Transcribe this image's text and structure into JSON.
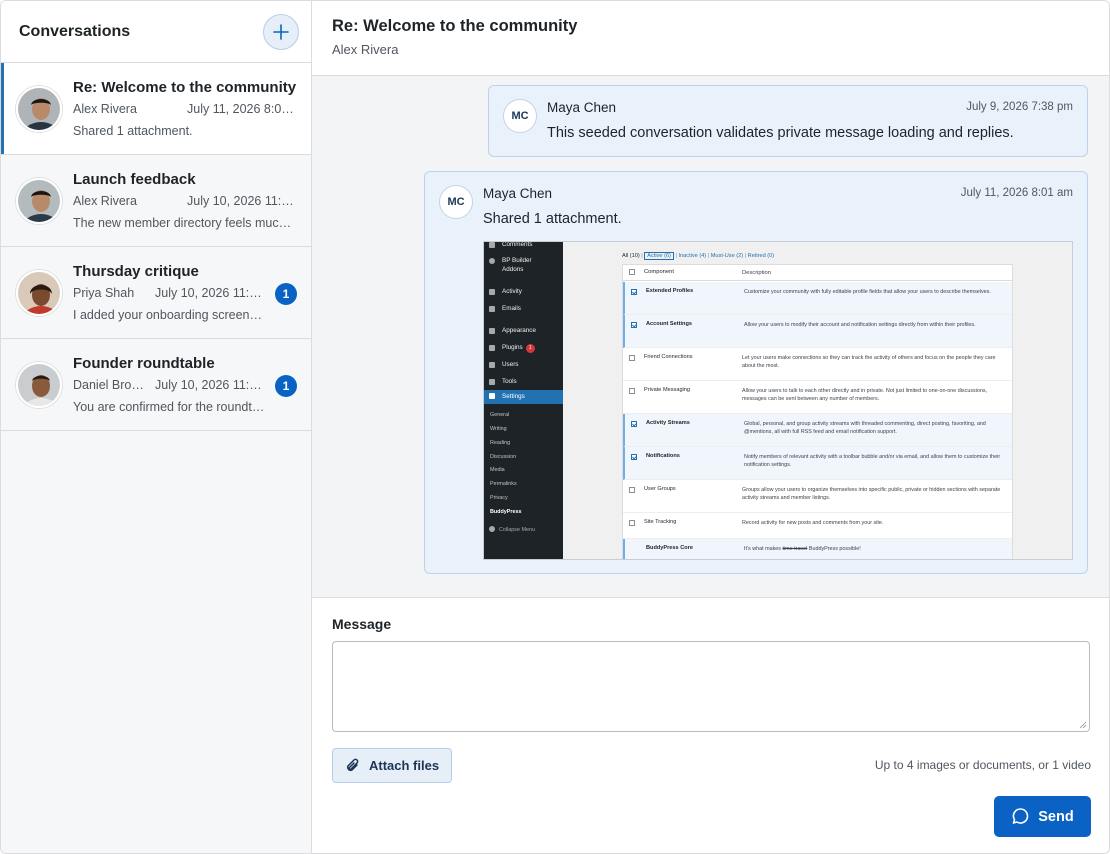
{
  "sidebar": {
    "title": "Conversations",
    "new_icon": "plus-icon",
    "conversations": [
      {
        "title": "Re: Welcome to the community",
        "author": "Alex Rivera",
        "date": "July 11, 2026 8:01 am",
        "preview": "Shared 1 attachment.",
        "active": true
      },
      {
        "title": "Launch feedback",
        "author": "Alex Rivera",
        "date": "July 10, 2026 11:32 am",
        "preview": "The new member directory feels much cleaner",
        "active": false
      },
      {
        "title": "Thursday critique",
        "author": "Priya Shah",
        "date": "July 10, 2026 11:32 am",
        "preview": "I added your onboarding screen to the critique",
        "unread": "1",
        "active": false
      },
      {
        "title": "Founder roundtable",
        "author": "Daniel Brooks",
        "date": "July 10, 2026 11:32 am",
        "preview": "You are confirmed for the roundtable",
        "unread": "1",
        "active": false
      }
    ]
  },
  "thread": {
    "title": "Re: Welcome to the community",
    "participant": "Alex Rivera",
    "messages": [
      {
        "initials": "MC",
        "sender": "Maya Chen",
        "date": "July 9, 2026 7:38 pm",
        "text": "This seeded conversation validates private message loading and replies."
      },
      {
        "initials": "MC",
        "sender": "Maya Chen",
        "date": "July 11, 2026 8:01 am",
        "text": "Shared 1 attachment."
      }
    ]
  },
  "attachment": {
    "menu": [
      "Comments",
      "BP Builder",
      "Addons",
      "Activity",
      "Emails",
      "Appearance",
      "Plugins",
      "Users",
      "Tools",
      "Settings"
    ],
    "plugins_badge": "1",
    "submenu": [
      "General",
      "Writing",
      "Reading",
      "Discussion",
      "Media",
      "Permalinks",
      "Privacy",
      "BuddyPress"
    ],
    "collapse": "Collapse Menu",
    "filters": {
      "all": "All (10)",
      "active": "Active (6)",
      "inactive": "Inactive (4)",
      "mustuse": "Must-Use (2)",
      "retired": "Retired (0)",
      "sep": "|"
    },
    "col_component": "Component",
    "col_description": "Description",
    "rows": [
      {
        "name": "Extended Profiles",
        "desc": "Customize your community with fully editable profile fields that allow your users to describe themselves.",
        "on": true
      },
      {
        "name": "Account Settings",
        "desc": "Allow your users to modify their account and notification settings directly from within their profiles.",
        "on": true
      },
      {
        "name": "Friend Connections",
        "desc": "Let your users make connections so they can track the activity of others and focus on the people they care about the most.",
        "on": false
      },
      {
        "name": "Private Messaging",
        "desc": "Allow your users to talk to each other directly and in private. Not just limited to one-on-one discussions, messages can be sent between any number of members.",
        "on": false
      },
      {
        "name": "Activity Streams",
        "desc": "Global, personal, and group activity streams with threaded commenting, direct posting, favoriting, and @mentions, all with full RSS feed and email notification support.",
        "on": true
      },
      {
        "name": "Notifications",
        "desc": "Notify members of relevant activity with a toolbar bubble and/or via email, and allow them to customize their notification settings.",
        "on": true
      },
      {
        "name": "User Groups",
        "desc": "Groups allow your users to organize themselves into specific public, private or hidden sections with separate activity streams and member listings.",
        "on": false
      },
      {
        "name": "Site Tracking",
        "desc": "Record activity for new posts and comments from your site.",
        "on": false
      },
      {
        "name": "BuddyPress Core",
        "desc_pre": "It's what makes ",
        "desc_strike": "time travel",
        "desc_post": " BuddyPress possible!",
        "on": false
      }
    ]
  },
  "composer": {
    "label": "Message",
    "placeholder": "",
    "attach_label": "Attach files",
    "attach_icon": "paperclip-icon",
    "hint": "Up to 4 images or documents, or 1 video",
    "send_label": "Send",
    "send_icon": "chat-bubble-icon"
  },
  "colors": {
    "accent": "#0a63c4",
    "active_bar": "#2271b1",
    "message_bg": "#e9f1fb"
  }
}
